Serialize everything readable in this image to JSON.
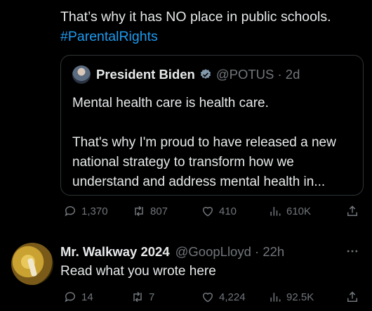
{
  "main_post": {
    "text": "That’s why it has NO place in public schools.",
    "hashtag": "#ParentalRights"
  },
  "quoted_post": {
    "name": "President Biden",
    "handle_time": "@POTUS · 2d",
    "body": "Mental health care is health care.\n\nThat's why I'm proud to have released a new national strategy to transform how we understand and address mental health in..."
  },
  "main_actions": {
    "replies": "1,370",
    "reposts": "807",
    "likes": "410",
    "views": "610K"
  },
  "reply_post": {
    "name": "Mr. Walkway 2024",
    "handle_time": "@GoopLloyd · 22h",
    "text": "Read what you wrote here"
  },
  "reply_actions": {
    "replies": "14",
    "reposts": "7",
    "likes": "4,224",
    "views": "92.5K"
  },
  "colors": {
    "background": "#000000",
    "text": "#e7e9ea",
    "muted": "#71767b",
    "link": "#1d9bf0",
    "verified": "#829aab"
  }
}
